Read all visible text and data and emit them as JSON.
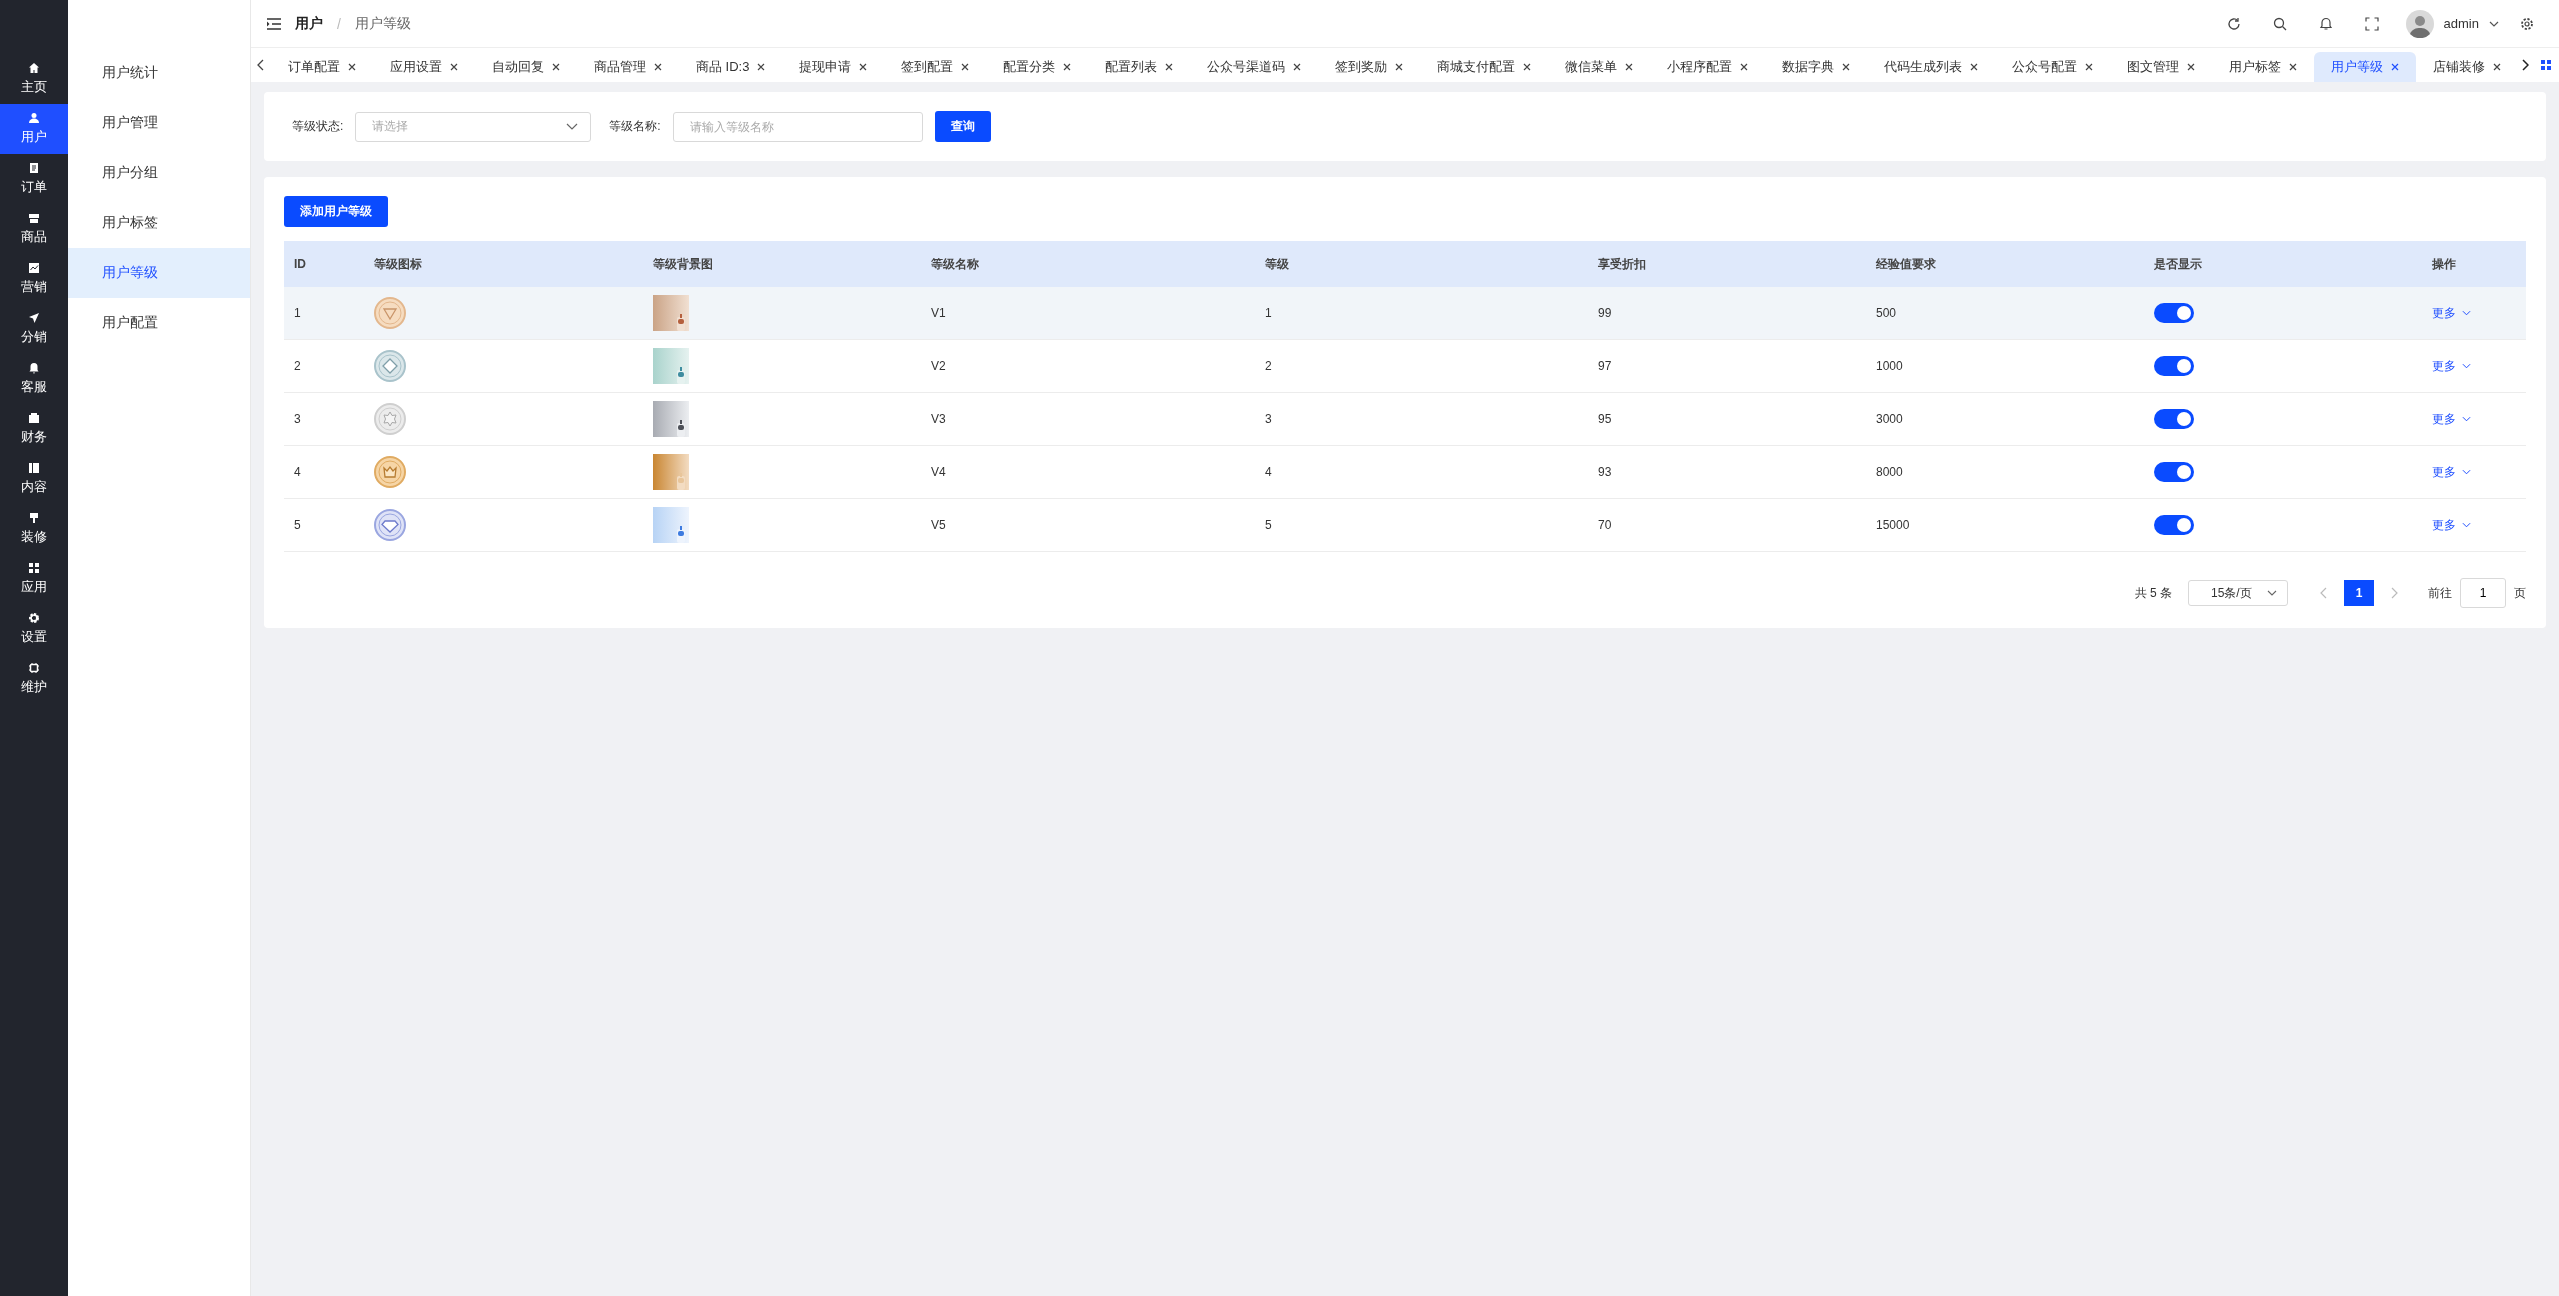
{
  "rail": [
    {
      "label": "主页",
      "selected": false
    },
    {
      "label": "用户",
      "selected": true
    },
    {
      "label": "订单",
      "selected": false
    },
    {
      "label": "商品",
      "selected": false
    },
    {
      "label": "营销",
      "selected": false
    },
    {
      "label": "分销",
      "selected": false
    },
    {
      "label": "客服",
      "selected": false
    },
    {
      "label": "财务",
      "selected": false
    },
    {
      "label": "内容",
      "selected": false
    },
    {
      "label": "装修",
      "selected": false
    },
    {
      "label": "应用",
      "selected": false
    },
    {
      "label": "设置",
      "selected": false
    },
    {
      "label": "维护",
      "selected": false
    }
  ],
  "submenu": [
    {
      "label": "用户统计",
      "selected": false
    },
    {
      "label": "用户管理",
      "selected": false
    },
    {
      "label": "用户分组",
      "selected": false
    },
    {
      "label": "用户标签",
      "selected": false
    },
    {
      "label": "用户等级",
      "selected": true
    },
    {
      "label": "用户配置",
      "selected": false
    }
  ],
  "breadcrumb": [
    "用户",
    "用户等级"
  ],
  "breadcrumb_separator": "/",
  "user": {
    "name": "admin"
  },
  "tabs": [
    {
      "label": "订单配置",
      "selected": false
    },
    {
      "label": "应用设置",
      "selected": false
    },
    {
      "label": "自动回复",
      "selected": false
    },
    {
      "label": "商品管理",
      "selected": false
    },
    {
      "label": "商品 ID:3",
      "selected": false
    },
    {
      "label": "提现申请",
      "selected": false
    },
    {
      "label": "签到配置",
      "selected": false
    },
    {
      "label": "配置分类",
      "selected": false
    },
    {
      "label": "配置列表",
      "selected": false
    },
    {
      "label": "公众号渠道码",
      "selected": false
    },
    {
      "label": "签到奖励",
      "selected": false
    },
    {
      "label": "商城支付配置",
      "selected": false
    },
    {
      "label": "微信菜单",
      "selected": false
    },
    {
      "label": "小程序配置",
      "selected": false
    },
    {
      "label": "数据字典",
      "selected": false
    },
    {
      "label": "代码生成列表",
      "selected": false
    },
    {
      "label": "公众号配置",
      "selected": false
    },
    {
      "label": "图文管理",
      "selected": false
    },
    {
      "label": "用户标签",
      "selected": false
    },
    {
      "label": "用户等级",
      "selected": true
    },
    {
      "label": "店铺装修",
      "selected": false
    }
  ],
  "filter": {
    "status_label": "等级状态:",
    "status_placeholder": "请选择",
    "name_label": "等级名称:",
    "name_placeholder": "请输入等级名称",
    "search_button": "查询"
  },
  "add_button": "添加用户等级",
  "table": {
    "columns": [
      "ID",
      "等级图标",
      "等级背景图",
      "等级名称",
      "等级",
      "享受折扣",
      "经验值要求",
      "是否显示",
      "操作"
    ],
    "rows": [
      {
        "id": "1",
        "name": "V1",
        "grade": "1",
        "discount": "99",
        "exp": "500",
        "on": true,
        "hovered": true,
        "action": "更多"
      },
      {
        "id": "2",
        "name": "V2",
        "grade": "2",
        "discount": "97",
        "exp": "1000",
        "on": true,
        "hovered": false,
        "action": "更多"
      },
      {
        "id": "3",
        "name": "V3",
        "grade": "3",
        "discount": "95",
        "exp": "3000",
        "on": true,
        "hovered": false,
        "action": "更多"
      },
      {
        "id": "4",
        "name": "V4",
        "grade": "4",
        "discount": "93",
        "exp": "8000",
        "on": true,
        "hovered": false,
        "action": "更多"
      },
      {
        "id": "5",
        "name": "V5",
        "grade": "5",
        "discount": "70",
        "exp": "15000",
        "on": true,
        "hovered": false,
        "action": "更多"
      }
    ]
  },
  "pagination": {
    "total": "共 5 条",
    "page_size": "15条/页",
    "pages": [
      {
        "label": "1",
        "selected": true
      }
    ],
    "goto_label": "前往",
    "goto_value": "1",
    "goto_suffix": "页"
  }
}
